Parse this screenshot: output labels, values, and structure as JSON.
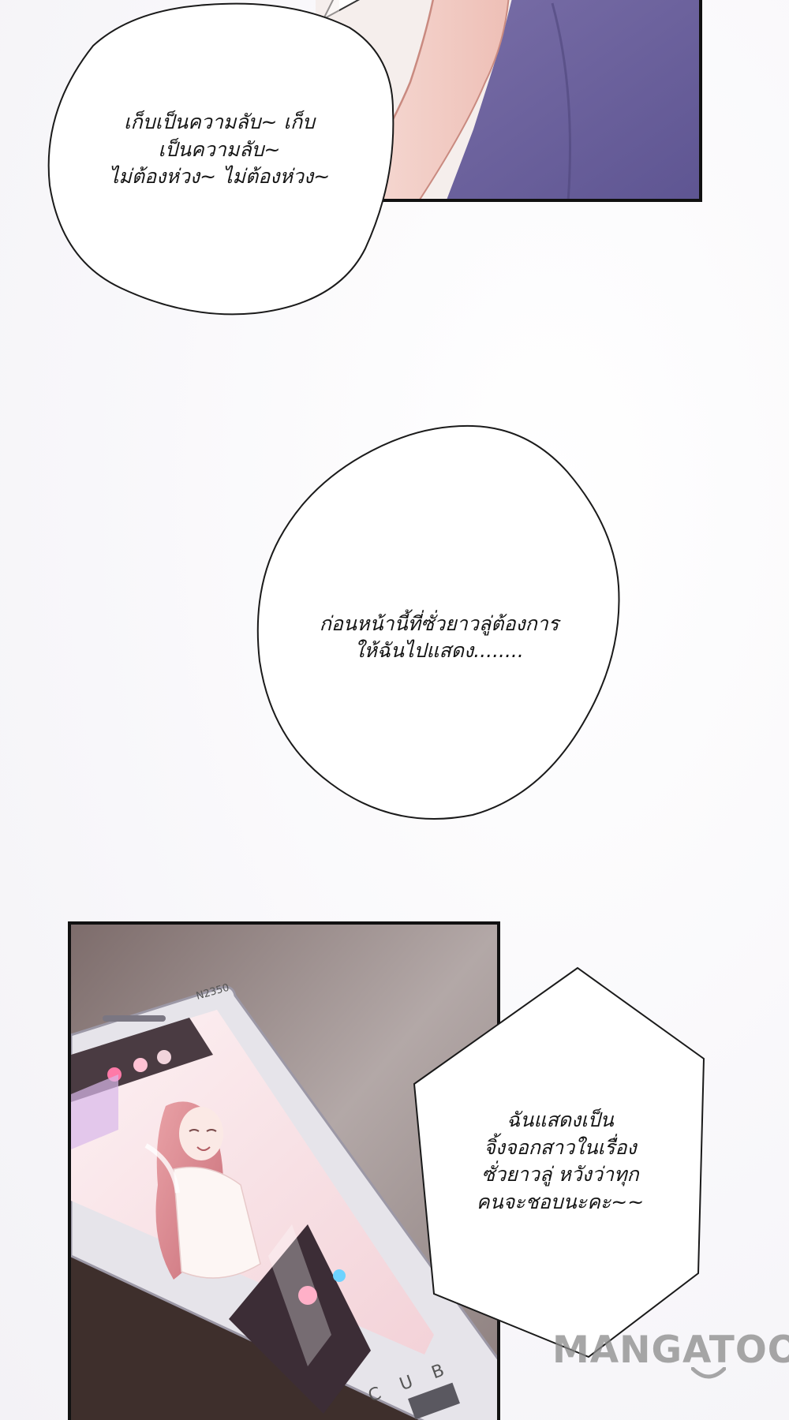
{
  "bubbles": {
    "top": {
      "lines": [
        "เก็บเป็นความลับ~ เก็บ",
        "เป็นความลับ~",
        "ไม่ต้องห่วง~ ไม่ต้องห่วง~"
      ]
    },
    "middle": {
      "lines": [
        "ก่อนหน้านี้ที่ซั่วยาวลู่ต้องการ",
        "ให้ฉันไปแสดง........"
      ]
    },
    "bottom": {
      "lines": [
        "ฉันแสดงเป็น",
        "จิ้งจอกสาวในเรื่อง",
        "ซั่วยาวลู่ หวังว่าทุก",
        "คนจะชอบนะคะ~~"
      ]
    }
  },
  "phone": {
    "model_label": "N2350",
    "brand_letters": "C U B"
  },
  "watermark": {
    "text": "MANGATOON"
  }
}
